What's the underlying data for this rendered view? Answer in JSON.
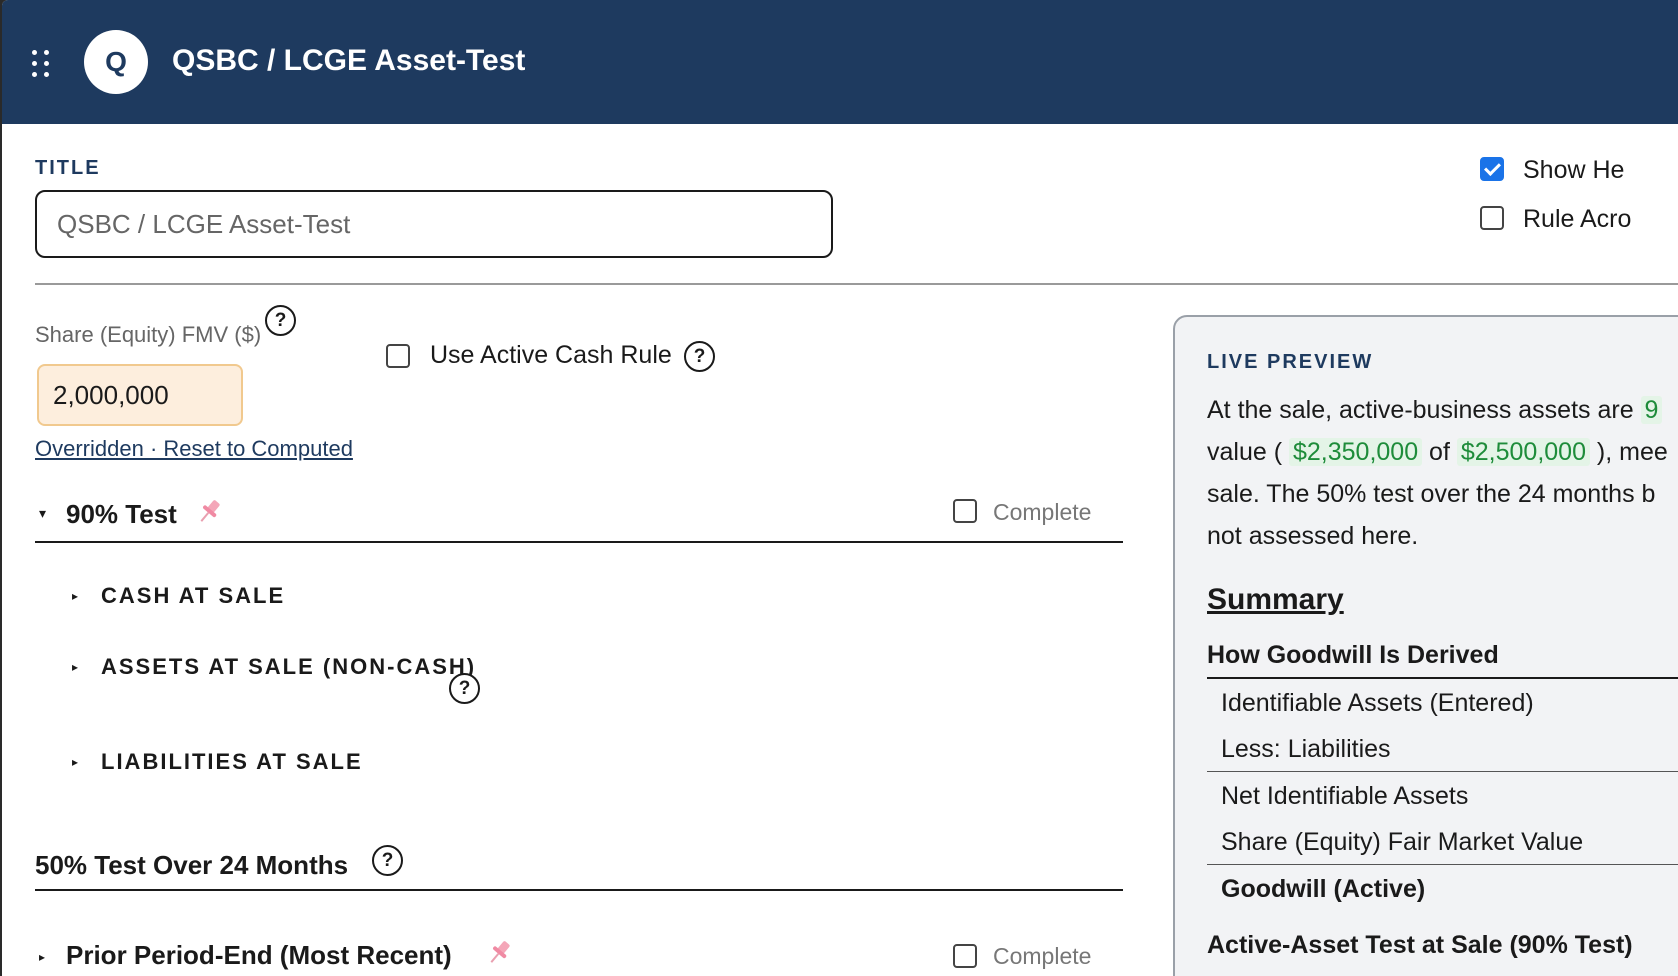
{
  "header": {
    "logo_letter": "Q",
    "title": "QSBC / LCGE Asset-Test"
  },
  "title_field": {
    "label": "TITLE",
    "placeholder": "QSBC / LCGE Asset-Test"
  },
  "options": {
    "show_help": {
      "label": "Show He",
      "checked": true
    },
    "rule_across": {
      "label": "Rule Acro",
      "checked": false
    }
  },
  "fmv": {
    "label": "Share (Equity) FMV ($)",
    "help": "?",
    "value": "2,000,000",
    "override_link": "Overridden · Reset to Computed"
  },
  "active_cash": {
    "label": "Use Active Cash Rule",
    "help": "?"
  },
  "test90": {
    "caret": "▾",
    "title": "90% Test",
    "complete_label": "Complete",
    "items": [
      {
        "caret": "▸",
        "label": "CASH AT SALE"
      },
      {
        "caret": "▸",
        "label": "ASSETS AT SALE (NON-CASH)",
        "help": "?"
      },
      {
        "caret": "▸",
        "label": "LIABILITIES AT SALE"
      }
    ]
  },
  "test50": {
    "title": "50% Test Over 24 Months",
    "help": "?"
  },
  "prior_period": {
    "caret": "▸",
    "title": "Prior Period-End (Most Recent)",
    "complete_label": "Complete"
  },
  "preview": {
    "label": "LIVE PREVIEW",
    "line1_a": "At the sale, active-business assets are ",
    "line1_b": "9",
    "line2_a": "value ( ",
    "line2_b": "$2,350,000",
    "line2_c": " of ",
    "line2_d": "$2,500,000",
    "line2_e": " ), mee",
    "line3": "sale. The 50% test over the 24 months b",
    "line4": "not assessed here.",
    "summary_title": "Summary",
    "goodwill_heading": "How Goodwill Is Derived",
    "rows": {
      "identifiable": "Identifiable Assets (Entered)",
      "liabilities": "Less: Liabilities",
      "net": "Net Identifiable Assets",
      "share_fmv": "Share (Equity) Fair Market Value",
      "goodwill": "Goodwill (Active)"
    },
    "active_asset_heading": "Active-Asset Test at Sale (90% Test)"
  },
  "colors": {
    "header_bg": "#1e3a5f",
    "accent": "#1a73e8",
    "override_bg": "#fdeedd",
    "green": "#1e8c3a"
  }
}
